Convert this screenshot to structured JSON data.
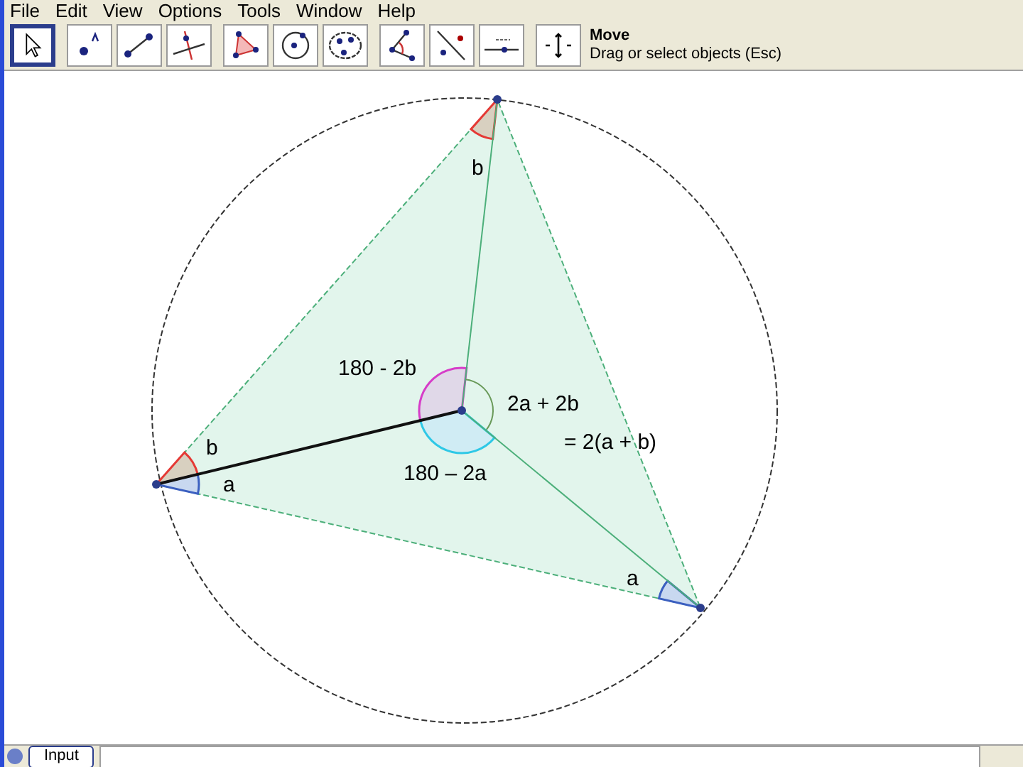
{
  "menu": [
    "File",
    "Edit",
    "View",
    "Options",
    "Tools",
    "Window",
    "Help"
  ],
  "toolbar": {
    "tools": [
      {
        "kind": "move",
        "selected": true
      },
      {
        "kind": "point",
        "selected": false
      },
      {
        "kind": "segment",
        "selected": false
      },
      {
        "kind": "perpendicular",
        "selected": false
      },
      {
        "kind": "polygon",
        "selected": false
      },
      {
        "kind": "circle",
        "selected": false
      },
      {
        "kind": "conic",
        "selected": false
      },
      {
        "kind": "angle",
        "selected": false
      },
      {
        "kind": "reflect",
        "selected": false
      },
      {
        "kind": "slider",
        "selected": false
      },
      {
        "kind": "graphics",
        "selected": false
      }
    ]
  },
  "tool_info": {
    "title": "Move",
    "description": "Drag or select objects (Esc)"
  },
  "canvas": {
    "labels": [
      "b",
      "180 - 2b",
      "2a + 2b",
      "= 2(a + b)",
      "b",
      "a",
      "180 – 2a",
      "a"
    ]
  },
  "input_bar": {
    "button": "Input"
  }
}
